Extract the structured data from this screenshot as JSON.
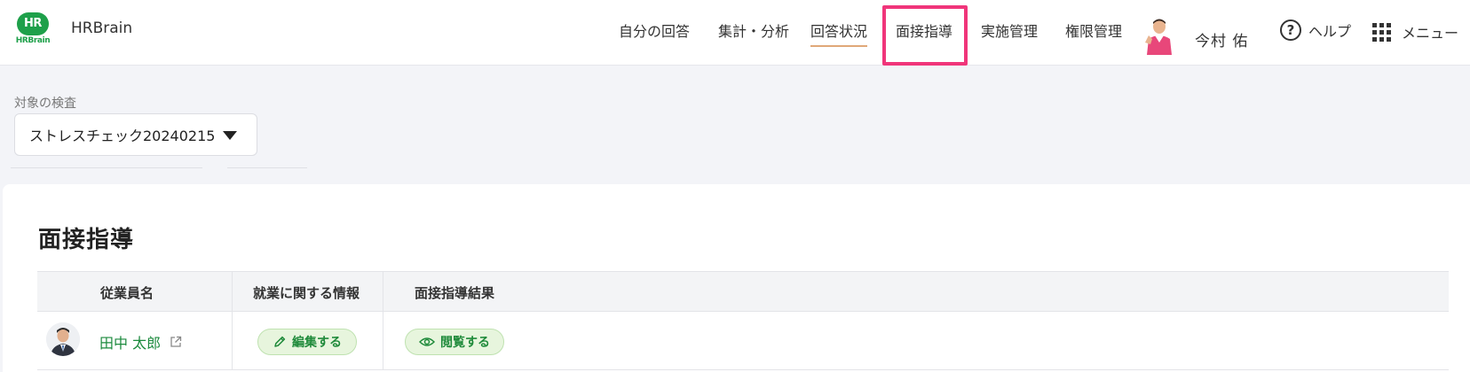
{
  "header": {
    "logo_mark": "HR",
    "logo_sub": "HRBrain",
    "logo_text": "HRBrain",
    "nav": [
      {
        "label": "自分の回答"
      },
      {
        "label": "集計・分析"
      },
      {
        "label": "回答状況"
      },
      {
        "label": "面接指導"
      },
      {
        "label": "実施管理"
      },
      {
        "label": "権限管理"
      }
    ],
    "active_nav": "回答状況",
    "highlighted_nav": "面接指導",
    "user_name": "今村 佑",
    "help_label": "ヘルプ",
    "help_icon": "question-circle-icon",
    "menu_label": "メニュー",
    "menu_icon": "grid-icon"
  },
  "target": {
    "label": "対象の検査",
    "selected": "ストレスチェック20240215"
  },
  "page": {
    "title": "面接指導",
    "columns": [
      "従業員名",
      "就業に関する情報",
      "面接指導結果"
    ],
    "rows": [
      {
        "name": "田中 太郎",
        "work_info_action": "編集する",
        "result_action": "閲覧する"
      }
    ]
  },
  "colors": {
    "brand_green": "#1ea04a",
    "highlight": "#f0357a",
    "pill_bg": "#e7f5dd",
    "pill_text": "#1f8a3a"
  }
}
